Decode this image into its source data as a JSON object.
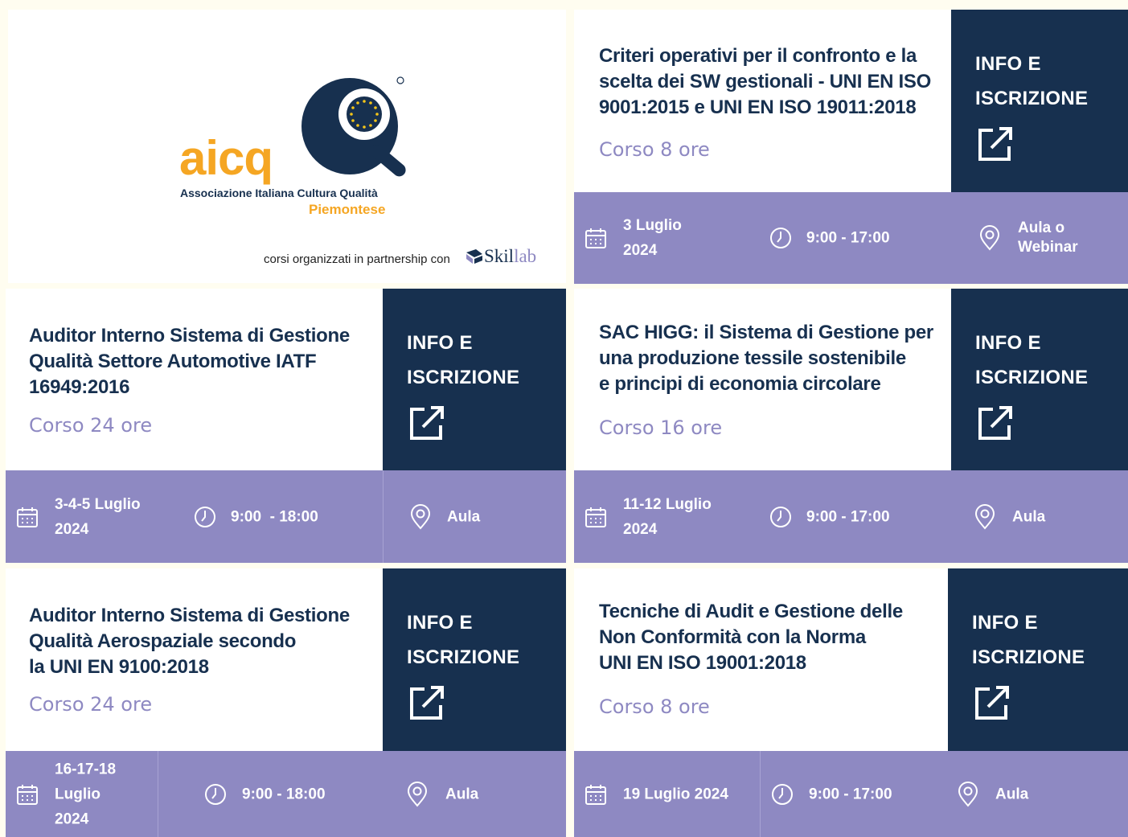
{
  "header": {
    "logo_text": "aicq",
    "logo_subtitle": "Associazione Italiana Cultura Qualità",
    "logo_region": "Piemontese",
    "partnership_text": "corsi organizzati in partnership con",
    "partner_logo_prefix": "Skil",
    "partner_logo_suffix": "lab"
  },
  "colors": {
    "navy": "#17304f",
    "lavender": "#8e89c2",
    "orange": "#f5a623",
    "background": "#fffdf0"
  },
  "info_button": {
    "line1": "INFO E",
    "line2": "ISCRIZIONE",
    "icon": "external-link-icon"
  },
  "courses": [
    {
      "title_lines": [
        "Criteri operativi per il confronto e la",
        "scelta dei SW gestionali - UNI EN ISO",
        "9001:2015 e UNI EN ISO 19011:2018"
      ],
      "hours": "Corso 8 ore",
      "date_lines": [
        "3 Luglio",
        "2024"
      ],
      "time": "9:00 - 17:00",
      "location_lines": [
        "Aula o",
        "Webinar"
      ]
    },
    {
      "title_lines": [
        "Auditor Interno Sistema di Gestione",
        "Qualità Settore Automotive IATF",
        "16949:2016"
      ],
      "hours": "Corso 24 ore",
      "date_lines": [
        "3-4-5 Luglio",
        "2024"
      ],
      "time": "9:00  - 18:00",
      "location_lines": [
        "Aula"
      ]
    },
    {
      "title_lines": [
        "SAC HIGG: il Sistema di Gestione per",
        "una produzione tessile sostenibile",
        "e principi di economia circolare"
      ],
      "hours": "Corso 16 ore",
      "date_lines": [
        "11-12 Luglio",
        "2024"
      ],
      "time": "9:00 - 17:00",
      "location_lines": [
        "Aula"
      ]
    },
    {
      "title_lines": [
        "Auditor Interno Sistema di Gestione",
        "Qualità Aerospaziale secondo",
        "la UNI EN 9100:2018"
      ],
      "hours": "Corso 24 ore",
      "date_lines": [
        "16-17-18 Luglio",
        "2024"
      ],
      "time": "9:00 - 18:00",
      "location_lines": [
        "Aula"
      ]
    },
    {
      "title_lines": [
        "Tecniche di Audit e Gestione delle",
        "Non Conformità con la Norma",
        "UNI EN ISO 19001:2018"
      ],
      "hours": "Corso 8 ore",
      "date_lines": [
        "19 Luglio 2024"
      ],
      "time": "9:00 - 17:00",
      "location_lines": [
        "Aula"
      ]
    }
  ]
}
